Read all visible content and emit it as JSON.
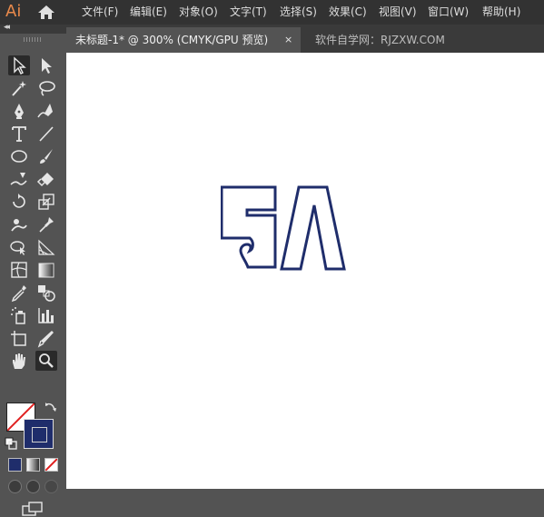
{
  "app": {
    "logo": "Ai"
  },
  "menu": [
    "文件(F)",
    "编辑(E)",
    "对象(O)",
    "文字(T)",
    "选择(S)",
    "效果(C)",
    "视图(V)",
    "窗口(W)",
    "帮助(H)"
  ],
  "tabs": {
    "active": "未标题-1* @ 300% (CMYK/GPU 预览)",
    "close": "×",
    "inactive": "软件自学网：RJZXW.COM"
  },
  "panel": {
    "collapse": "◂◂"
  },
  "tools": [
    "selection-tool",
    "direct-selection-tool",
    "magic-wand-tool",
    "lasso-tool",
    "pen-tool",
    "curvature-tool",
    "type-tool",
    "line-segment-tool",
    "ellipse-tool",
    "paintbrush-tool",
    "shaper-tool",
    "eraser-tool",
    "rotate-tool",
    "scale-tool",
    "puppet-warp-tool",
    "free-transform-tool",
    "shape-builder-tool",
    "perspective-grid-tool",
    "mesh-tool",
    "gradient-tool",
    "eyedropper-tool",
    "blend-tool",
    "symbol-sprayer-tool",
    "column-graph-tool",
    "artboard-tool",
    "slice-tool",
    "hand-tool",
    "zoom-tool"
  ],
  "colors": {
    "stroke": "#1f2d6b",
    "fill": "none",
    "accent": "#e8894b"
  },
  "canvas": {
    "artwork_text": "SA",
    "zoom": "300%"
  }
}
